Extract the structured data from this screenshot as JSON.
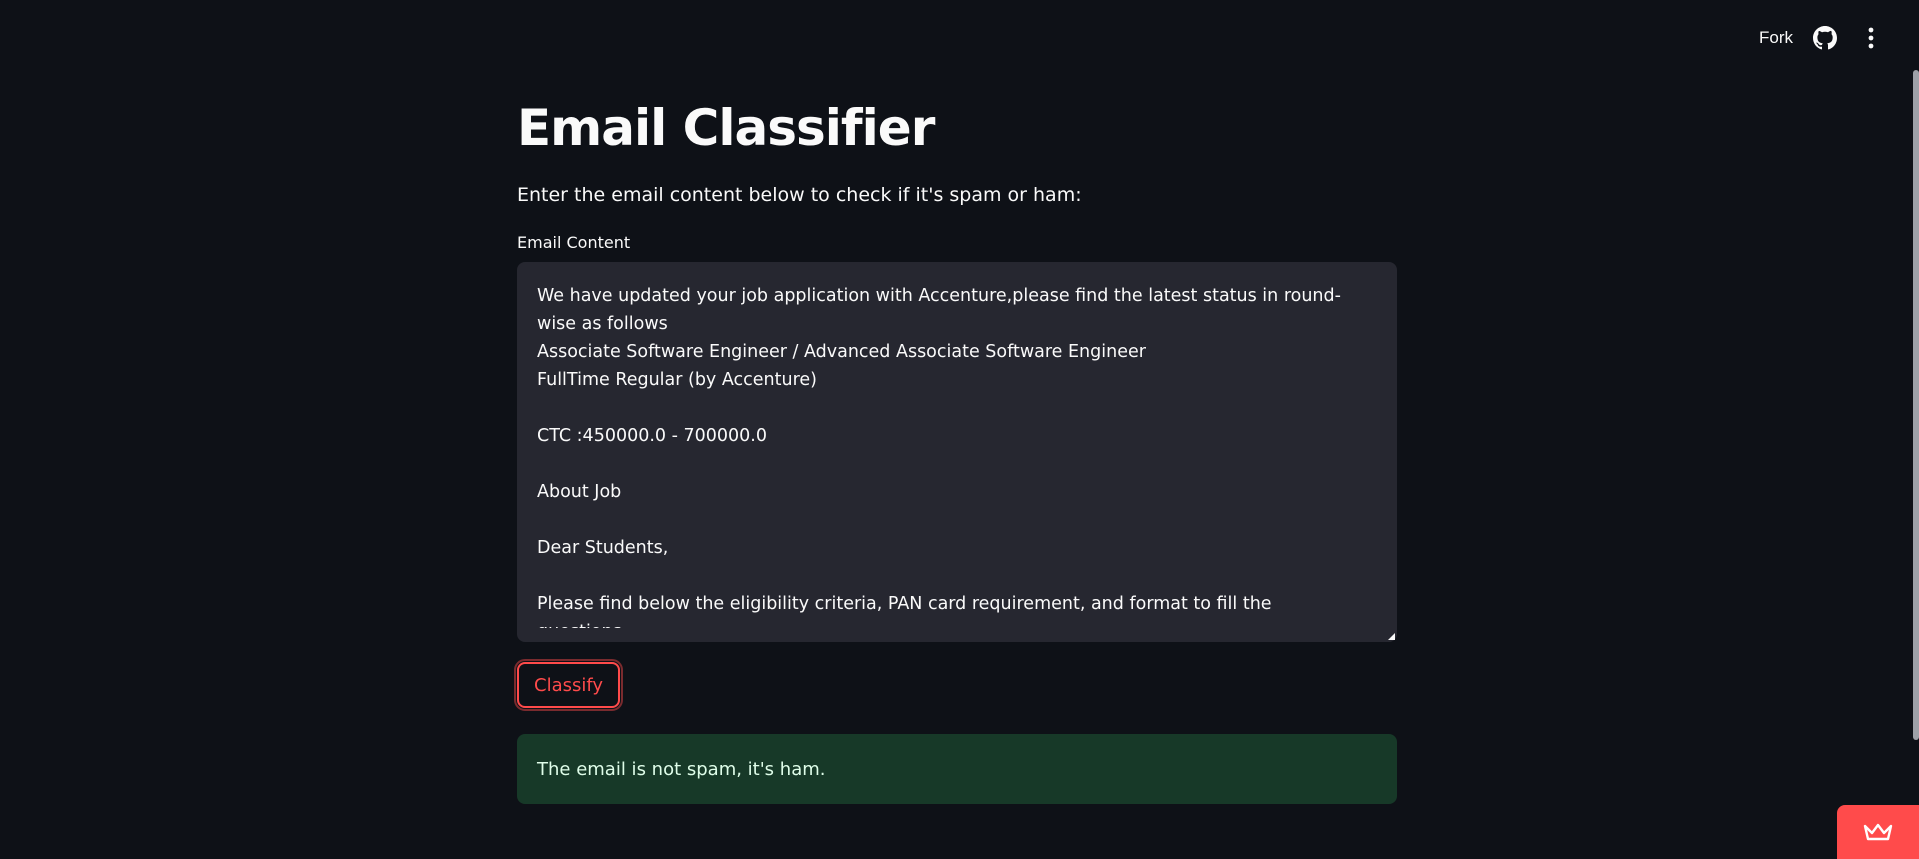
{
  "header": {
    "fork_label": "Fork",
    "github_icon": "github-icon",
    "menu_icon": "kebab-menu-icon"
  },
  "main": {
    "title": "Email Classifier",
    "subtitle": "Enter the email content below to check if it's spam or ham:",
    "field_label": "Email Content",
    "email_content": "We have updated your job application with Accenture,please find the latest status in round-wise as follows\nAssociate Software Engineer / Advanced Associate Software Engineer\nFullTime Regular (by Accenture)\n\nCTC :450000.0 - 700000.0\n\nAbout Job\n\nDear Students,\n\nPlease find below the eligibility criteria, PAN card requirement, and format to fill the questions.",
    "classify_label": "Classify",
    "result_text": "The email is not spam, it's ham."
  },
  "badge": {
    "icon": "crown-icon"
  },
  "colors": {
    "background": "#0e1117",
    "input_background": "#262730",
    "accent": "#ff4b4b",
    "success_background": "#173928"
  }
}
